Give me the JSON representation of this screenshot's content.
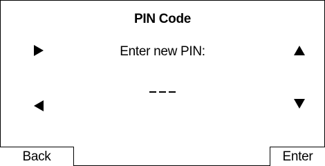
{
  "screen": {
    "title": "PIN Code",
    "prompt": "Enter new PIN:",
    "pin_slot_count": 3
  },
  "nav": {
    "left_icons": [
      "arrow-right-icon",
      "arrow-left-icon"
    ],
    "right_icons": [
      "arrow-up-icon",
      "arrow-down-icon"
    ]
  },
  "softkeys": {
    "back_label": "Back",
    "enter_label": "Enter"
  }
}
